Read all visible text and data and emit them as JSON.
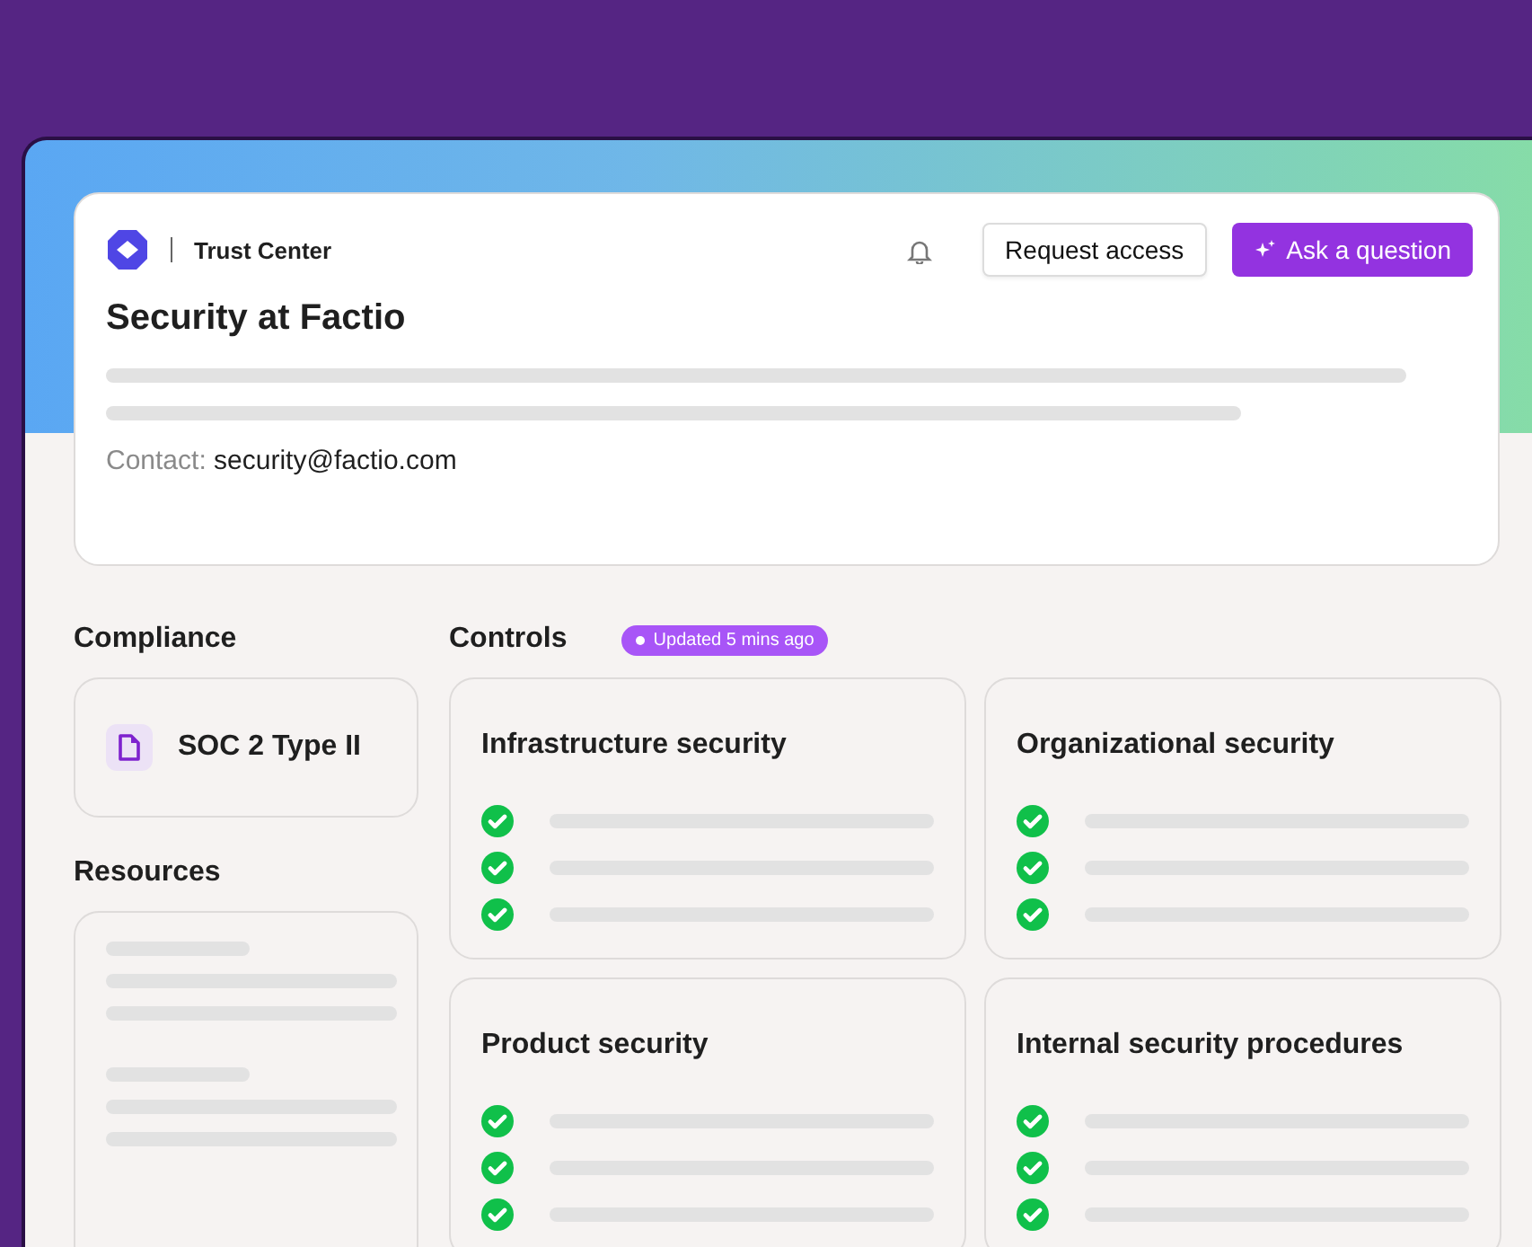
{
  "header": {
    "brand": "Trust Center",
    "title": "Security at Factio",
    "contact_label": "Contact:",
    "contact_email": "security@factio.com",
    "buttons": [
      {
        "label": "Request access",
        "kind": "secondary"
      },
      {
        "label": "Ask a question",
        "kind": "primary"
      }
    ]
  },
  "compliance": {
    "heading": "Compliance",
    "items": [
      {
        "label": "SOC 2 Type II"
      }
    ]
  },
  "resources": {
    "heading": "Resources"
  },
  "controls": {
    "heading": "Controls",
    "badge": "Updated 5 mins ago",
    "cards": [
      {
        "title": "Infrastructure security",
        "items": [
          {
            "checked": true
          },
          {
            "checked": true
          },
          {
            "checked": true
          }
        ]
      },
      {
        "title": "Organizational security",
        "items": [
          {
            "checked": true
          },
          {
            "checked": true
          },
          {
            "checked": true
          }
        ]
      },
      {
        "title": "Product security",
        "items": [
          {
            "checked": true
          },
          {
            "checked": true
          },
          {
            "checked": true
          }
        ]
      },
      {
        "title": "Internal security procedures",
        "items": [
          {
            "checked": true
          },
          {
            "checked": true
          },
          {
            "checked": true
          }
        ]
      }
    ]
  }
}
